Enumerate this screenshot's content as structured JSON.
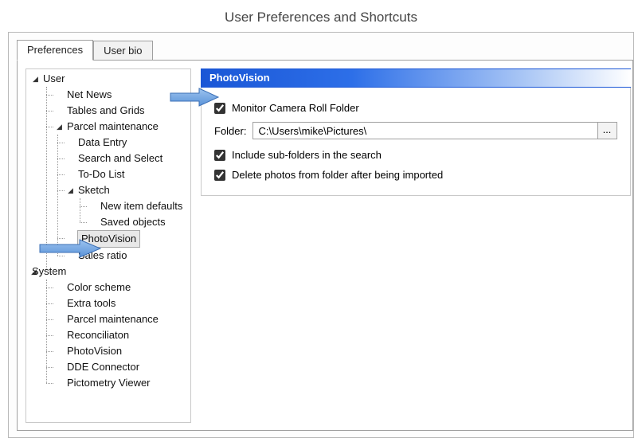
{
  "title": "User Preferences and Shortcuts",
  "tabs": {
    "preferences": "Preferences",
    "userbio": "User bio"
  },
  "tree": {
    "user": "User",
    "netnews": "Net News",
    "tablesgrids": "Tables and Grids",
    "parcelmaint": "Parcel maintenance",
    "dataentry": "Data Entry",
    "searchselect": "Search and Select",
    "todolist": "To-Do List",
    "sketch": "Sketch",
    "newitemde": "New item defaults",
    "savedobjec": "Saved objects",
    "photovision": "PhotoVision",
    "salesratio": "Sales ratio",
    "system": "System",
    "colorscheme": "Color scheme",
    "extratools": "Extra tools",
    "sys_parcelmaint": "Parcel maintenance",
    "reconciliation": "Reconciliaton",
    "sys_photovision": "PhotoVision",
    "ddeconnector": "DDE Connector",
    "pictometry": "Pictometry Viewer"
  },
  "panel": {
    "header": "PhotoVision",
    "monitor_label": "Monitor Camera Roll Folder",
    "folder_label": "Folder:",
    "folder_value": "C:\\Users\\mike\\Pictures\\",
    "browse_label": "...",
    "include_sub_label": "Include sub-folders in the search",
    "delete_after_label": "Delete photos from folder after being imported"
  }
}
